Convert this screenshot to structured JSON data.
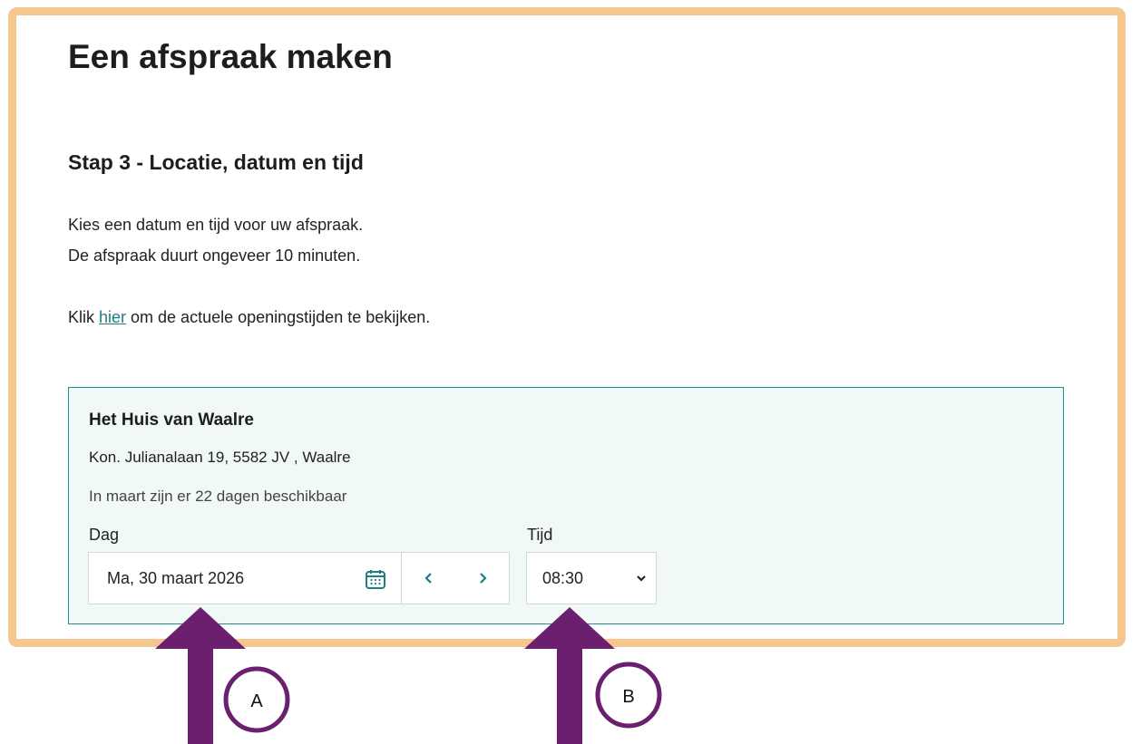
{
  "page": {
    "title": "Een afspraak maken",
    "step_title": "Stap 3 - Locatie, datum en tijd",
    "intro_line1": "Kies een datum en tijd voor uw afspraak.",
    "intro_line2": "De afspraak duurt ongeveer 10 minuten.",
    "link_prefix": "Klik ",
    "link_text": "hier",
    "link_suffix": " om de actuele openingstijden te bekijken."
  },
  "location": {
    "name": "Het Huis van Waalre",
    "address": "Kon. Julianalaan 19, 5582 JV , Waalre",
    "availability": "In maart zijn er 22 dagen beschikbaar"
  },
  "form": {
    "day_label": "Dag",
    "day_value": "Ma, 30 maart 2026",
    "time_label": "Tijd",
    "time_value": "08:30"
  },
  "icons": {
    "calendar": "calendar-icon",
    "prev": "chevron-left-icon",
    "next": "chevron-right-icon",
    "dropdown": "chevron-down-icon"
  },
  "annotations": {
    "a_label": "A",
    "b_label": "B"
  },
  "colors": {
    "frame_border": "#f5c68d",
    "accent": "#1c7d84",
    "card_bg": "#f1f8f8",
    "card_border": "#2b8c8f",
    "arrow": "#6b1f6f"
  }
}
